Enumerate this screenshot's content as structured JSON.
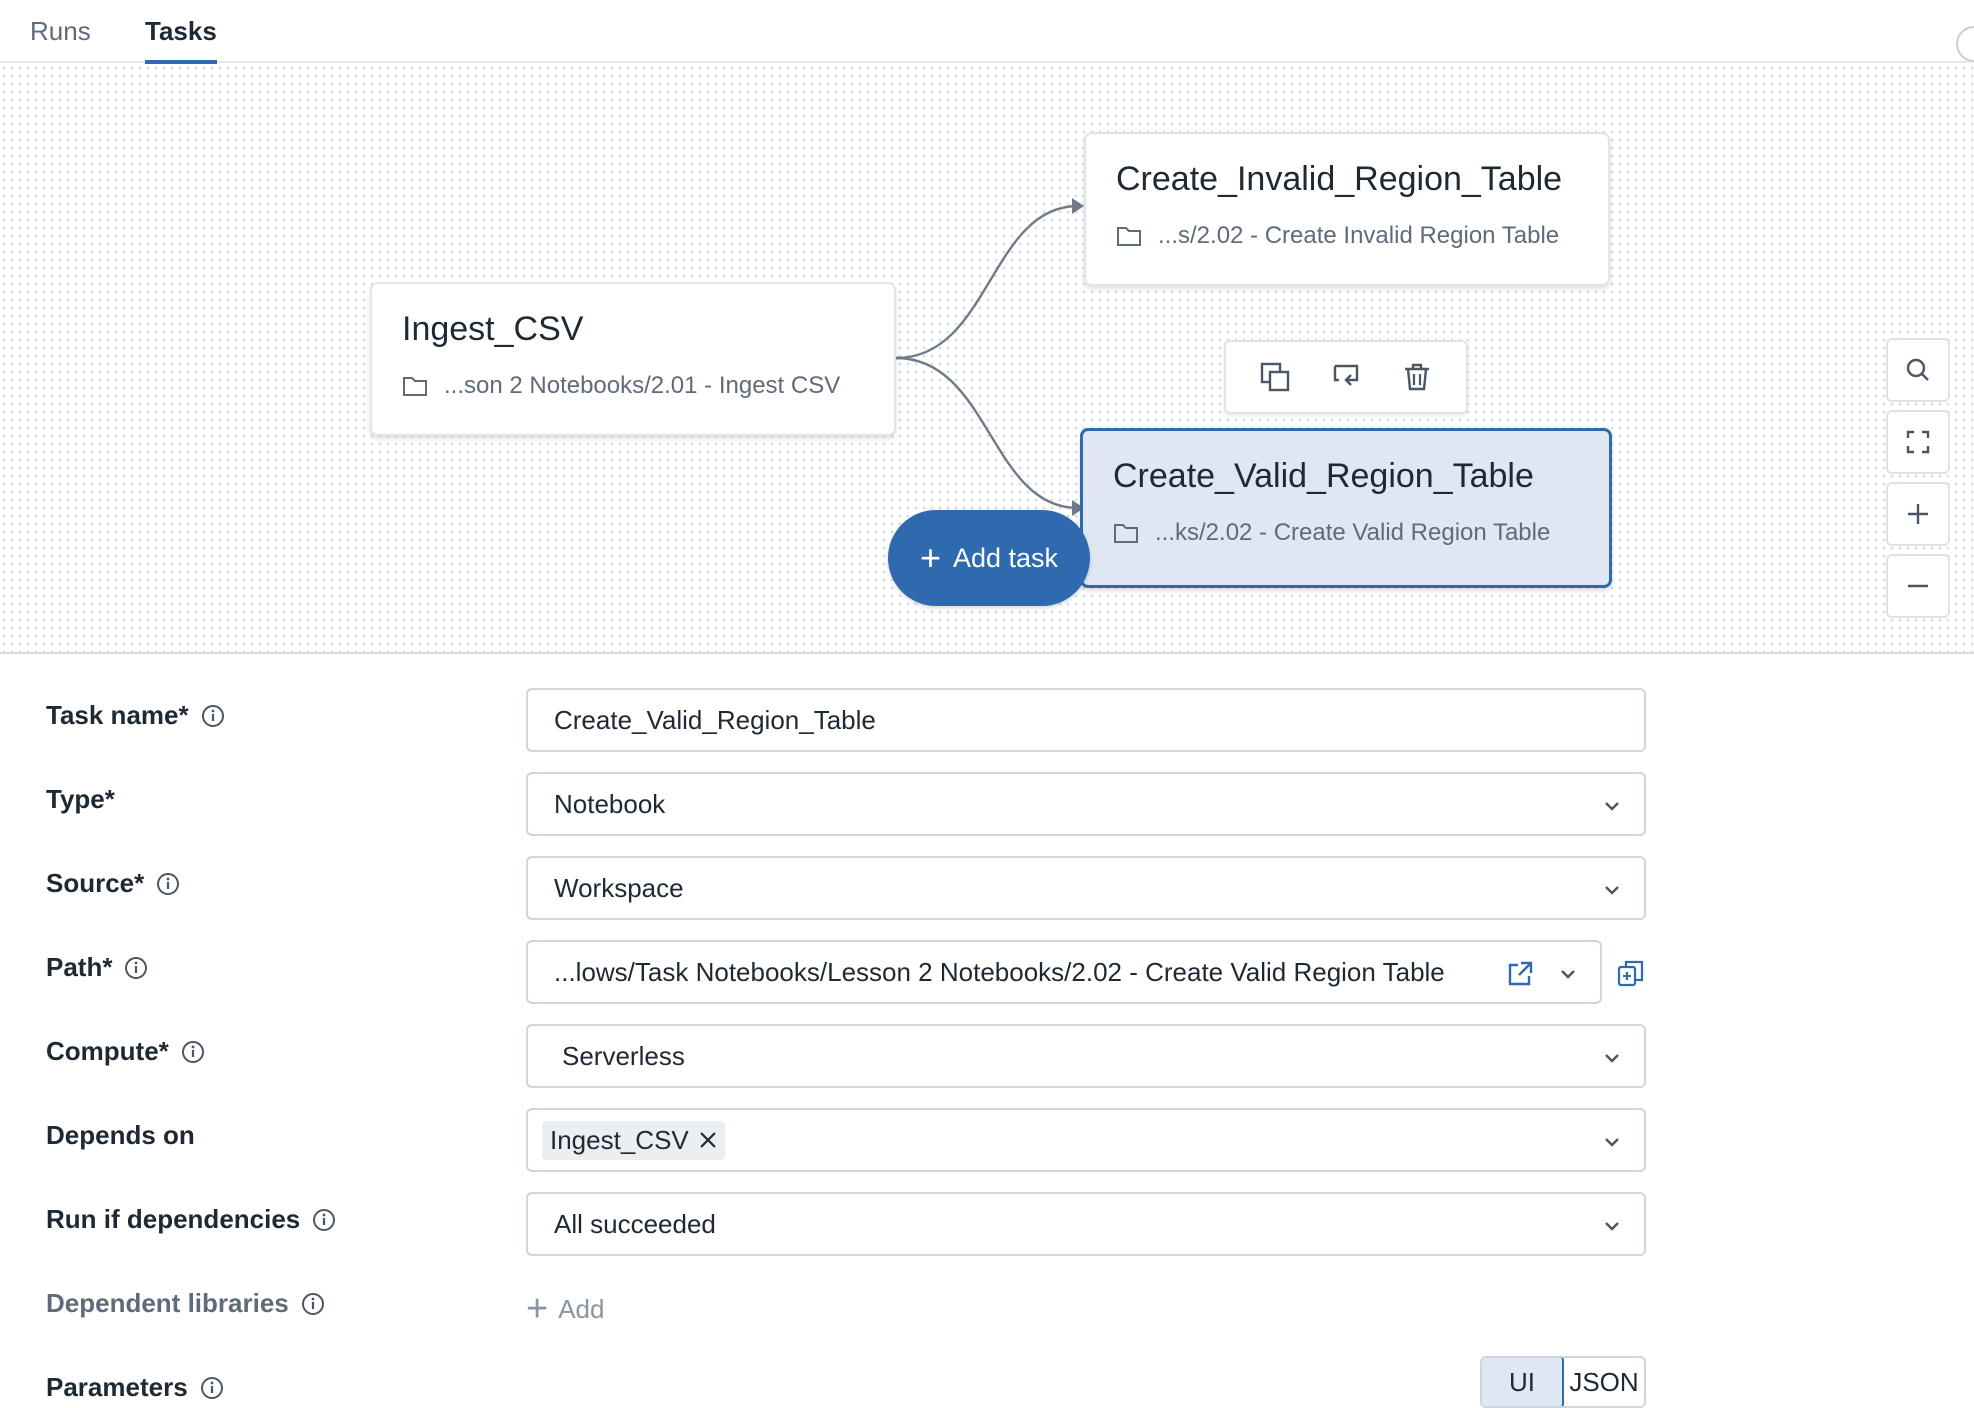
{
  "tabs": [
    {
      "label": "Runs",
      "active": false
    },
    {
      "label": "Tasks",
      "active": true
    }
  ],
  "graph": {
    "nodes": [
      {
        "title": "Ingest_CSV",
        "path": "...son 2 Notebooks/2.01 - Ingest CSV",
        "selected": false
      },
      {
        "title": "Create_Invalid_Region_Table",
        "path": "...s/2.02 - Create Invalid Region Table",
        "selected": false
      },
      {
        "title": "Create_Valid_Region_Table",
        "path": "...ks/2.02 - Create Valid Region Table",
        "selected": true
      }
    ],
    "node_toolbar": [
      "clone-icon",
      "switch-icon",
      "trash-icon"
    ],
    "add_task_label": "Add task",
    "zoom_controls": [
      "search-icon",
      "fit-view-icon",
      "zoom-in-icon",
      "zoom-out-icon"
    ]
  },
  "form": {
    "task_name": {
      "label": "Task name*",
      "value": "Create_Valid_Region_Table"
    },
    "type": {
      "label": "Type*",
      "value": "Notebook"
    },
    "source": {
      "label": "Source*",
      "value": "Workspace"
    },
    "path": {
      "label": "Path*",
      "value": "...lows/Task Notebooks/Lesson 2 Notebooks/2.02 - Create Valid Region Table"
    },
    "compute": {
      "label": "Compute*",
      "value": "Serverless"
    },
    "depends_on": {
      "label": "Depends on",
      "chips": [
        "Ingest_CSV"
      ]
    },
    "run_if": {
      "label": "Run if dependencies",
      "value": "All succeeded"
    },
    "dependent_libraries": {
      "label": "Dependent libraries",
      "add_label": "Add"
    },
    "parameters": {
      "label": "Parameters",
      "toggle": [
        "UI",
        "JSON"
      ],
      "active": "UI"
    }
  },
  "colors": {
    "accent": "#2e6aad",
    "selected_bg": "#dfe7f3",
    "muted_text": "#5f6b7a"
  }
}
